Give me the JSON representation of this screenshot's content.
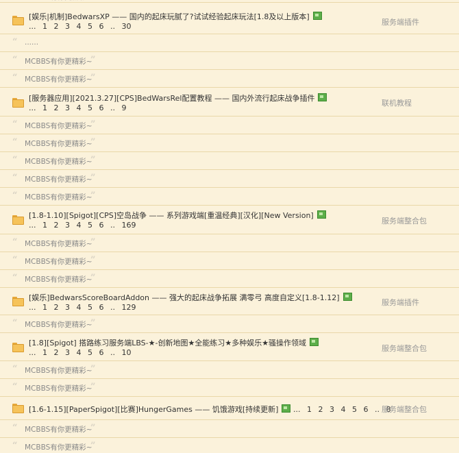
{
  "threads": [
    {
      "title": "[娱乐|机制]BedwarsXP —— 国内的起床玩腻了?试试经验起床玩法[1.8及以上版本]",
      "pages": [
        "...",
        "1",
        "2",
        "3",
        "4",
        "5",
        "6",
        "..",
        "30"
      ],
      "category": "服务端插件",
      "replies": [
        "......"
      ]
    },
    {
      "title": "[服务器应用][2021.3.27][CPS]BedWarsRel配置教程 —— 国内外流行起床战争插件",
      "pages": [
        "...",
        "1",
        "2",
        "3",
        "4",
        "5",
        "6",
        "..",
        "9"
      ],
      "category": "联机教程",
      "replies": [
        "MCBBS有你更精彩~",
        "MCBBS有你更精彩~",
        "MCBBS有你更精彩~",
        "MCBBS有你更精彩~",
        "MCBBS有你更精彩~"
      ]
    },
    {
      "title": "[1.8-1.10][Spigot][CPS]空岛战争 —— 系列游戏端[重温经典][汉化][New Version]",
      "pages": [
        "...",
        "1",
        "2",
        "3",
        "4",
        "5",
        "6",
        "..",
        "169"
      ],
      "category": "服务端整合包",
      "replies": [
        "MCBBS有你更精彩~",
        "MCBBS有你更精彩~",
        "MCBBS有你更精彩~"
      ]
    },
    {
      "title": "[娱乐]BedwarsScoreBoardAddon —— 强大的起床战争拓展 满零弓 高度自定义[1.8-1.12]",
      "pages": [
        "...",
        "1",
        "2",
        "3",
        "4",
        "5",
        "6",
        "..",
        "129"
      ],
      "category": "服务端插件",
      "replies": [
        "MCBBS有你更精彩~"
      ]
    },
    {
      "title": "[1.8][Spigot] 搭路练习服务端LBS-★-创新地图★全能练习★多种娱乐★骚操作领域",
      "pages": [
        "...",
        "1",
        "2",
        "3",
        "4",
        "5",
        "6",
        "..",
        "10"
      ],
      "category": "服务端整合包",
      "replies": [
        "MCBBS有你更精彩~",
        "MCBBS有你更精彩~"
      ]
    },
    {
      "title": "[1.6-1.15][PaperSpigot][比赛]HungerGames —— 饥饿游戏[持续更新]",
      "pages": [
        "...",
        "1",
        "2",
        "3",
        "4",
        "5",
        "6",
        "..",
        "8"
      ],
      "category": "服务端整合包",
      "replies": [
        "MCBBS有你更精彩~",
        "MCBBS有你更精彩~"
      ]
    }
  ],
  "top_reply": "MCBBS有你更精彩~"
}
